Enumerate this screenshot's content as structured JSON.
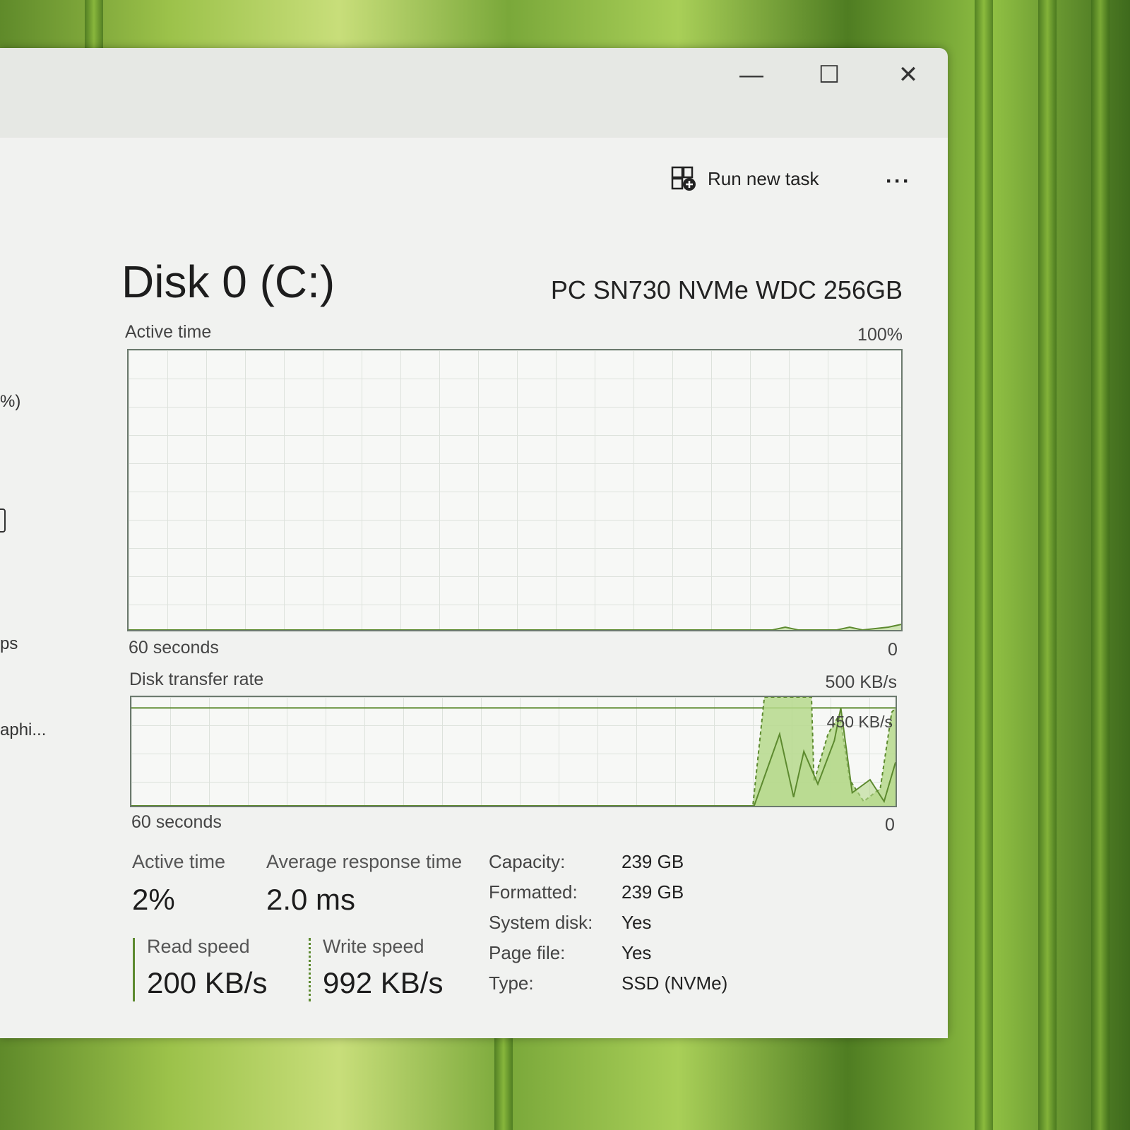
{
  "window_controls": {
    "minimize": "—",
    "maximize": "☐",
    "close": "✕"
  },
  "sidebar_fragments": [
    "%)",
    "ps",
    "aphi..."
  ],
  "toolbar": {
    "run_new_task": "Run new task",
    "more": "···"
  },
  "disk": {
    "title": "Disk 0 (C:)",
    "model": "PC SN730 NVMe WDC 256GB"
  },
  "active_chart": {
    "label": "Active time",
    "max": "100%",
    "time_span": "60 seconds",
    "min": "0"
  },
  "transfer_chart": {
    "label": "Disk transfer rate",
    "max": "500 KB/s",
    "marker": "450 KB/s",
    "time_span": "60 seconds",
    "min": "0"
  },
  "stats": {
    "active_time_label": "Active time",
    "active_time": "2%",
    "avg_response_label": "Average response time",
    "avg_response": "2.0 ms",
    "read_label": "Read speed",
    "read": "200 KB/s",
    "write_label": "Write speed",
    "write": "992 KB/s"
  },
  "properties": [
    {
      "label": "Capacity:",
      "value": "239 GB"
    },
    {
      "label": "Formatted:",
      "value": "239 GB"
    },
    {
      "label": "System disk:",
      "value": "Yes"
    },
    {
      "label": "Page file:",
      "value": "Yes"
    },
    {
      "label": "Type:",
      "value": "SSD (NVMe)"
    }
  ],
  "colors": {
    "fill": "#b6d98c",
    "stroke": "#5d8a2f",
    "grid": "#dde2dc"
  },
  "chart_data": [
    {
      "type": "area",
      "title": "Active time",
      "ylim": [
        0,
        100
      ],
      "xlim": [
        60,
        0
      ],
      "xlabel": "seconds ago",
      "series": [
        {
          "name": "Active time %",
          "points": [
            [
              60,
              0
            ],
            [
              10,
              0
            ],
            [
              9,
              1
            ],
            [
              8,
              0
            ],
            [
              5,
              0
            ],
            [
              4,
              1
            ],
            [
              3,
              0
            ],
            [
              1,
              1
            ],
            [
              0,
              2
            ]
          ]
        }
      ]
    },
    {
      "type": "area",
      "title": "Disk transfer rate",
      "ylim": [
        0,
        500
      ],
      "xlim": [
        60,
        0
      ],
      "xlabel": "seconds ago",
      "marker_line": 450,
      "series": [
        {
          "name": "Write speed",
          "style": "dashed",
          "points": [
            [
              60,
              0
            ],
            [
              11.2,
              0
            ],
            [
              10.3,
              500
            ],
            [
              6.6,
              500
            ],
            [
              6.4,
              110
            ],
            [
              5.3,
              330
            ],
            [
              4.4,
              420
            ],
            [
              3.6,
              120
            ],
            [
              2.5,
              20
            ],
            [
              1.2,
              80
            ],
            [
              0.3,
              430
            ],
            [
              0,
              450
            ]
          ]
        },
        {
          "name": "Read speed",
          "style": "solid",
          "points": [
            [
              60,
              0
            ],
            [
              11.1,
              0
            ],
            [
              9.1,
              330
            ],
            [
              8,
              40
            ],
            [
              7.2,
              250
            ],
            [
              6.1,
              100
            ],
            [
              4.8,
              300
            ],
            [
              4.3,
              450
            ],
            [
              3.4,
              60
            ],
            [
              2,
              120
            ],
            [
              0.9,
              20
            ],
            [
              0,
              200
            ]
          ]
        }
      ]
    }
  ]
}
